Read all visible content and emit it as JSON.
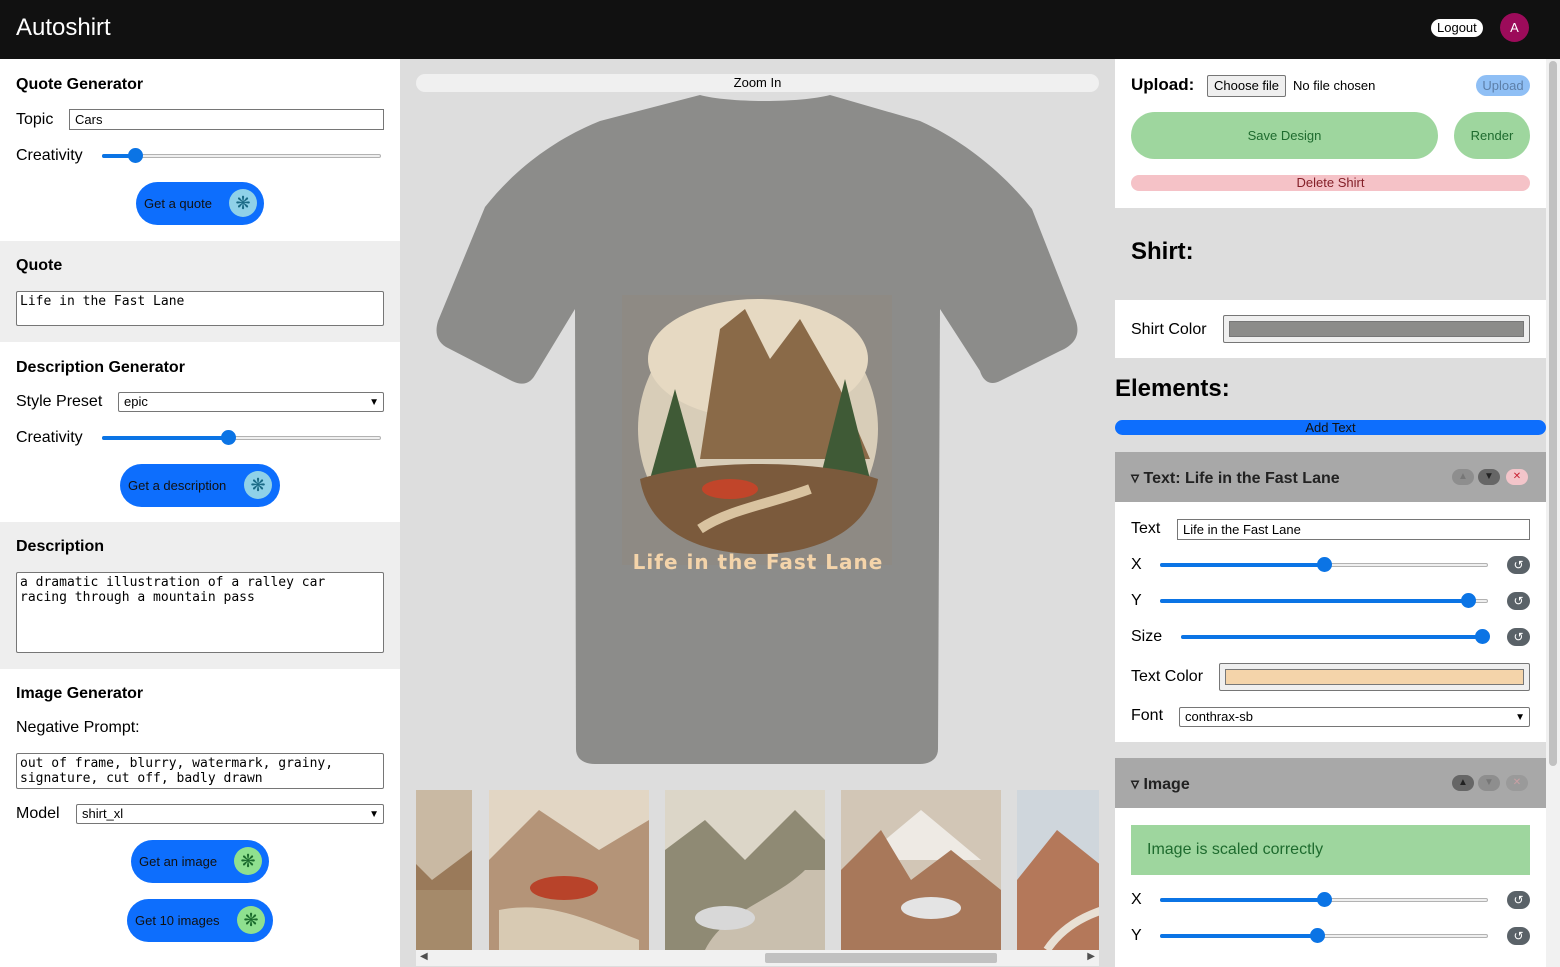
{
  "app": {
    "title": "Autoshirt",
    "logout_label": "Logout",
    "avatar_initial": "A"
  },
  "quote_generator": {
    "heading": "Quote Generator",
    "topic_label": "Topic",
    "topic_value": "Cars",
    "creativity_label": "Creativity",
    "creativity_level": 0.12,
    "button_label": "Get a quote"
  },
  "quote": {
    "heading": "Quote",
    "value": "Life in the Fast Lane"
  },
  "description_generator": {
    "heading": "Description Generator",
    "style_label": "Style Preset",
    "style_value": "epic",
    "creativity_label": "Creativity",
    "creativity_level": 0.45,
    "button_label": "Get a description"
  },
  "description": {
    "heading": "Description",
    "value": "a dramatic illustration of a ralley car\nracing through a mountain pass"
  },
  "image_generator": {
    "heading": "Image Generator",
    "negative_label": "Negative Prompt:",
    "negative_value": "out of frame, blurry, watermark, grainy,\nsignature, cut off, badly drawn",
    "model_label": "Model",
    "model_value": "shirt_xl",
    "button_label": "Get an image",
    "button10_label": "Get 10 images"
  },
  "canvas": {
    "zoom_label": "Zoom In",
    "shirt_text": "Life in the Fast Lane",
    "shirt_color": "#8c8c8a",
    "text_color": "#f4d4aa"
  },
  "toolbar": {
    "upload_label": "Upload:",
    "choose_file_label": "Choose file",
    "no_file_label": "No file chosen",
    "upload_button": "Upload",
    "save_label": "Save Design",
    "render_label": "Render",
    "delete_label": "Delete Shirt"
  },
  "shirt_panel": {
    "heading": "Shirt:",
    "color_label": "Shirt Color",
    "color_value": "#8c8c8a"
  },
  "elements": {
    "heading": "Elements:",
    "add_text_label": "Add Text",
    "text_element": {
      "title": "▿ Text: Life in the Fast Lane",
      "text_label": "Text",
      "text_value": "Life in the Fast Lane",
      "x_label": "X",
      "x_level": 0.5,
      "y_label": "Y",
      "y_level": 0.94,
      "size_label": "Size",
      "size_level": 0.99,
      "color_label": "Text Color",
      "color_value": "#f4d4aa",
      "font_label": "Font",
      "font_value": "conthrax-sb"
    },
    "image_element": {
      "title": "▿ Image",
      "status": "Image is scaled correctly",
      "x_label": "X",
      "x_level": 0.5,
      "y_label": "Y",
      "y_level": 0.48
    }
  },
  "colors": {
    "accent": "#0d6efd",
    "topbar": "#111111",
    "success": "#9ed69e",
    "danger": "#f5c2c7"
  }
}
